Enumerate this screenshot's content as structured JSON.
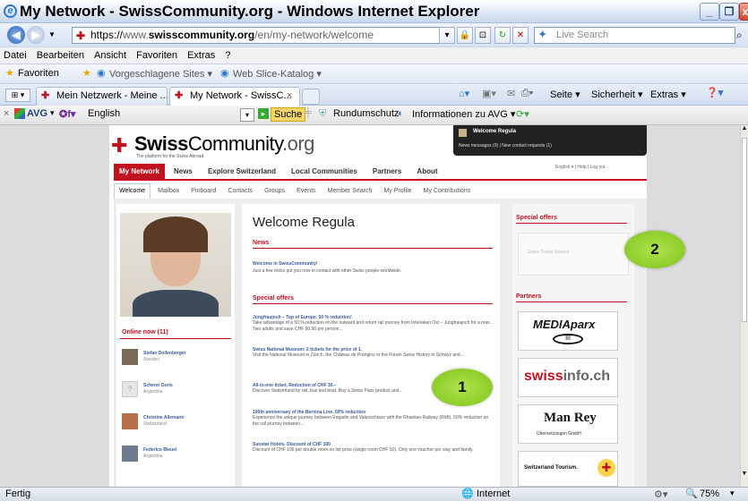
{
  "window": {
    "title": "My Network - SwissCommunity.org - Windows Internet Explorer"
  },
  "address": {
    "proto": "https://",
    "prefix": "www.",
    "domain": "swisscommunity.org",
    "path": "/en/my-network/welcome",
    "search_placeholder": "Live Search"
  },
  "menu": [
    "Datei",
    "Bearbeiten",
    "Ansicht",
    "Favoriten",
    "Extras",
    "?"
  ],
  "favbar": {
    "favorites": "Favoriten",
    "suggested": "Vorgeschlagene Sites ▾",
    "webslice": "Web Slice-Katalog ▾"
  },
  "tabs": [
    {
      "label": "Mein Netzwerk - Meine ..."
    },
    {
      "label": "My Network - SwissC..."
    }
  ],
  "tab_tools": {
    "seite": "Seite ▾",
    "sicherheit": "Sicherheit ▾",
    "extras": "Extras ▾"
  },
  "avg": {
    "label": "AVG",
    "language": "English",
    "search_btn": "Suche",
    "rundumschutz": "Rundumschutz",
    "info": "Informationen zu AVG ▾"
  },
  "site": {
    "logo_swiss": "Swiss",
    "logo_community": "Community",
    "logo_org": ".org",
    "tagline": "The platform for the Swiss Abroad",
    "welcome_badge": "Welcome Regula",
    "badge_links": "News messages (0) | New contact requests (1)",
    "top_links": "English ▾  |  Help  |  Log out",
    "main_nav": [
      "My Network",
      "News",
      "Explore Switzerland",
      "Local Communities",
      "Partners",
      "About"
    ],
    "sub_nav": [
      "Welcome",
      "Mailbox",
      "Pinboard",
      "Contacts",
      "Groups",
      "Events",
      "Member Search",
      "My Profile",
      "My Contributions"
    ],
    "online_now": "Online now (11)",
    "members": [
      {
        "name": "Stefan Dollenberger",
        "country": "Sweden"
      },
      {
        "name": "Scherer Doris",
        "country": "Argentina"
      },
      {
        "name": "Christine Allemann",
        "country": "Switzerland"
      },
      {
        "name": "Federico Bleuel",
        "country": "Argentina"
      }
    ],
    "welcome_title": "Welcome Regula",
    "news_heading": "News",
    "news_item_title": "Welcome in SwissCommunity!",
    "news_item_body": "Just a few clicks put you now in contact with other Swiss people worldwide.",
    "offers_heading": "Special offers",
    "offers": [
      {
        "title": "Jungfraujoch – Top of Europe. 50 % reduction!",
        "body": "Take advantage of a 50 % reduction on the outward and return rail journey from Interlaken Ost – Jungfraujoch for a max. Two adults and save CHF 90.90 per person..."
      },
      {
        "title": "Swiss National Museum: 2 tickets for the price of 1.",
        "body": "Visit the National Museum in Zürich, the Château de Prangins or the Forum Swiss History in Schwyz and..."
      },
      {
        "title": "All-in-one ticket. Reduction of CHF 30.–",
        "body": "Discover Switzerland by rail, bus and boat. Buy a Swiss Pass product and..."
      },
      {
        "title": "100th anniversary of the Bernina Line. 50% reduction",
        "body": "Experience the unique journey between Engadin and Valposchiavo with the Rhaetian Railway (RhB). 50% reduction on the rail journey between..."
      },
      {
        "title": "Sunstar Hotels. Discount of CHF 100",
        "body": "Discount of CHF 100 per double room on list price (single room CHF 50). Only one voucher per stay and family."
      }
    ],
    "right_offers_heading": "Special offers",
    "right_offer_text": "Swiss Travel System",
    "partners_heading": "Partners",
    "partners": {
      "mediaparx": "MEDIAparx",
      "swissinfo_a": "swiss",
      "swissinfo_b": "info.ch",
      "manrey": "Man Rey",
      "manrey_sub": "Übersetzungen GmbH",
      "swisstourism": "Switzerland Tourism."
    }
  },
  "callouts": {
    "one": "1",
    "two": "2"
  },
  "status": {
    "left": "Fertig",
    "zone": "Internet",
    "zoom": "75%"
  }
}
